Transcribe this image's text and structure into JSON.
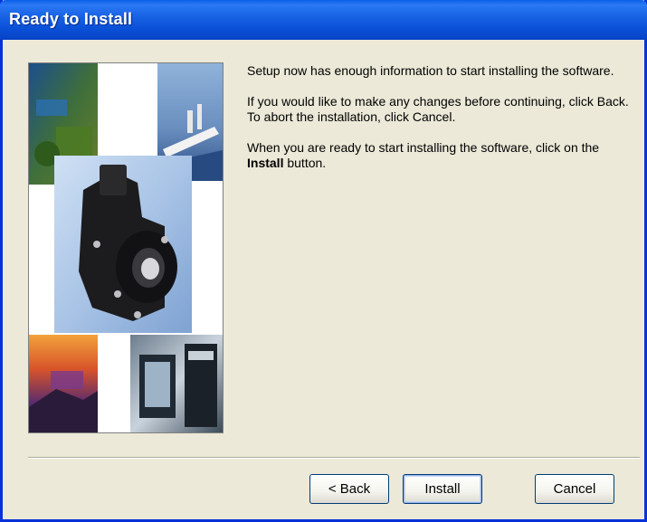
{
  "window": {
    "title": "Ready to Install"
  },
  "content": {
    "paragraph1": "Setup now has enough information to start installing the software.",
    "paragraph2": "If you would like to make any changes before continuing, click Back.  To abort the installation, click Cancel.",
    "paragraph3_prefix": "When you are ready to start installing the software, click on the ",
    "paragraph3_bold": "Install",
    "paragraph3_suffix": " button."
  },
  "buttons": {
    "back": "< Back",
    "install": "Install",
    "cancel": "Cancel"
  },
  "banner": {
    "icons": [
      "satellite-photo",
      "ship-photo",
      "encoder-device-photo",
      "sunset-photo",
      "machine-photo"
    ]
  },
  "colors": {
    "titlebar": "#0a4fd6",
    "dialog_bg": "#ece9d8",
    "frame": "#0831d9"
  }
}
